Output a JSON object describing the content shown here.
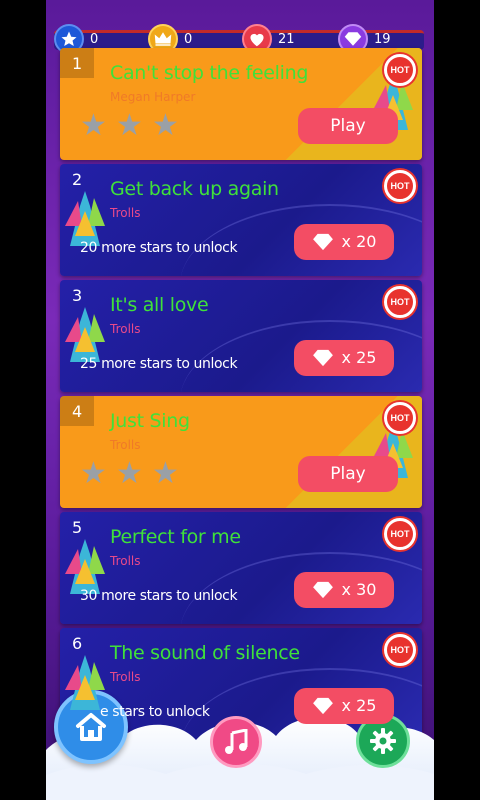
{
  "stats": {
    "stars": "0",
    "crowns": "0",
    "lives": "21",
    "gems": "19"
  },
  "songs": [
    {
      "num": "1",
      "title": "Can't stop the feeling",
      "artist": "Megan Harper",
      "state": "unlocked",
      "stars_earned": 0,
      "action": "Play",
      "badge": "HOT"
    },
    {
      "num": "2",
      "title": "Get back up again",
      "artist": "Trolls",
      "state": "locked",
      "unlock_text": "20 more stars to unlock",
      "cost": "x 20",
      "badge": "HOT"
    },
    {
      "num": "3",
      "title": "It's all love",
      "artist": "Trolls",
      "state": "locked",
      "unlock_text": "25 more stars to unlock",
      "cost": "x 25",
      "badge": "HOT"
    },
    {
      "num": "4",
      "title": "Just Sing",
      "artist": "Trolls",
      "state": "unlocked",
      "stars_earned": 0,
      "action": "Play",
      "badge": "HOT"
    },
    {
      "num": "5",
      "title": "Perfect for me",
      "artist": "Trolls",
      "state": "locked",
      "unlock_text": "30 more stars to unlock",
      "cost": "x 30",
      "badge": "HOT"
    },
    {
      "num": "6",
      "title": "The sound of silence",
      "artist": "Trolls",
      "state": "locked",
      "unlock_text": "e stars to unlock",
      "cost": "x 25",
      "badge": "HOT"
    }
  ],
  "colors": {
    "title_green": "#3fe13a",
    "play_red": "#f34d64",
    "card_orange": "#f99a1a",
    "card_blue": "#1f1c98"
  },
  "icons": [
    "star-icon",
    "crown-icon",
    "heart-icon",
    "diamond-icon",
    "hot-badge-icon",
    "home-icon",
    "music-note-icon",
    "gear-icon"
  ]
}
